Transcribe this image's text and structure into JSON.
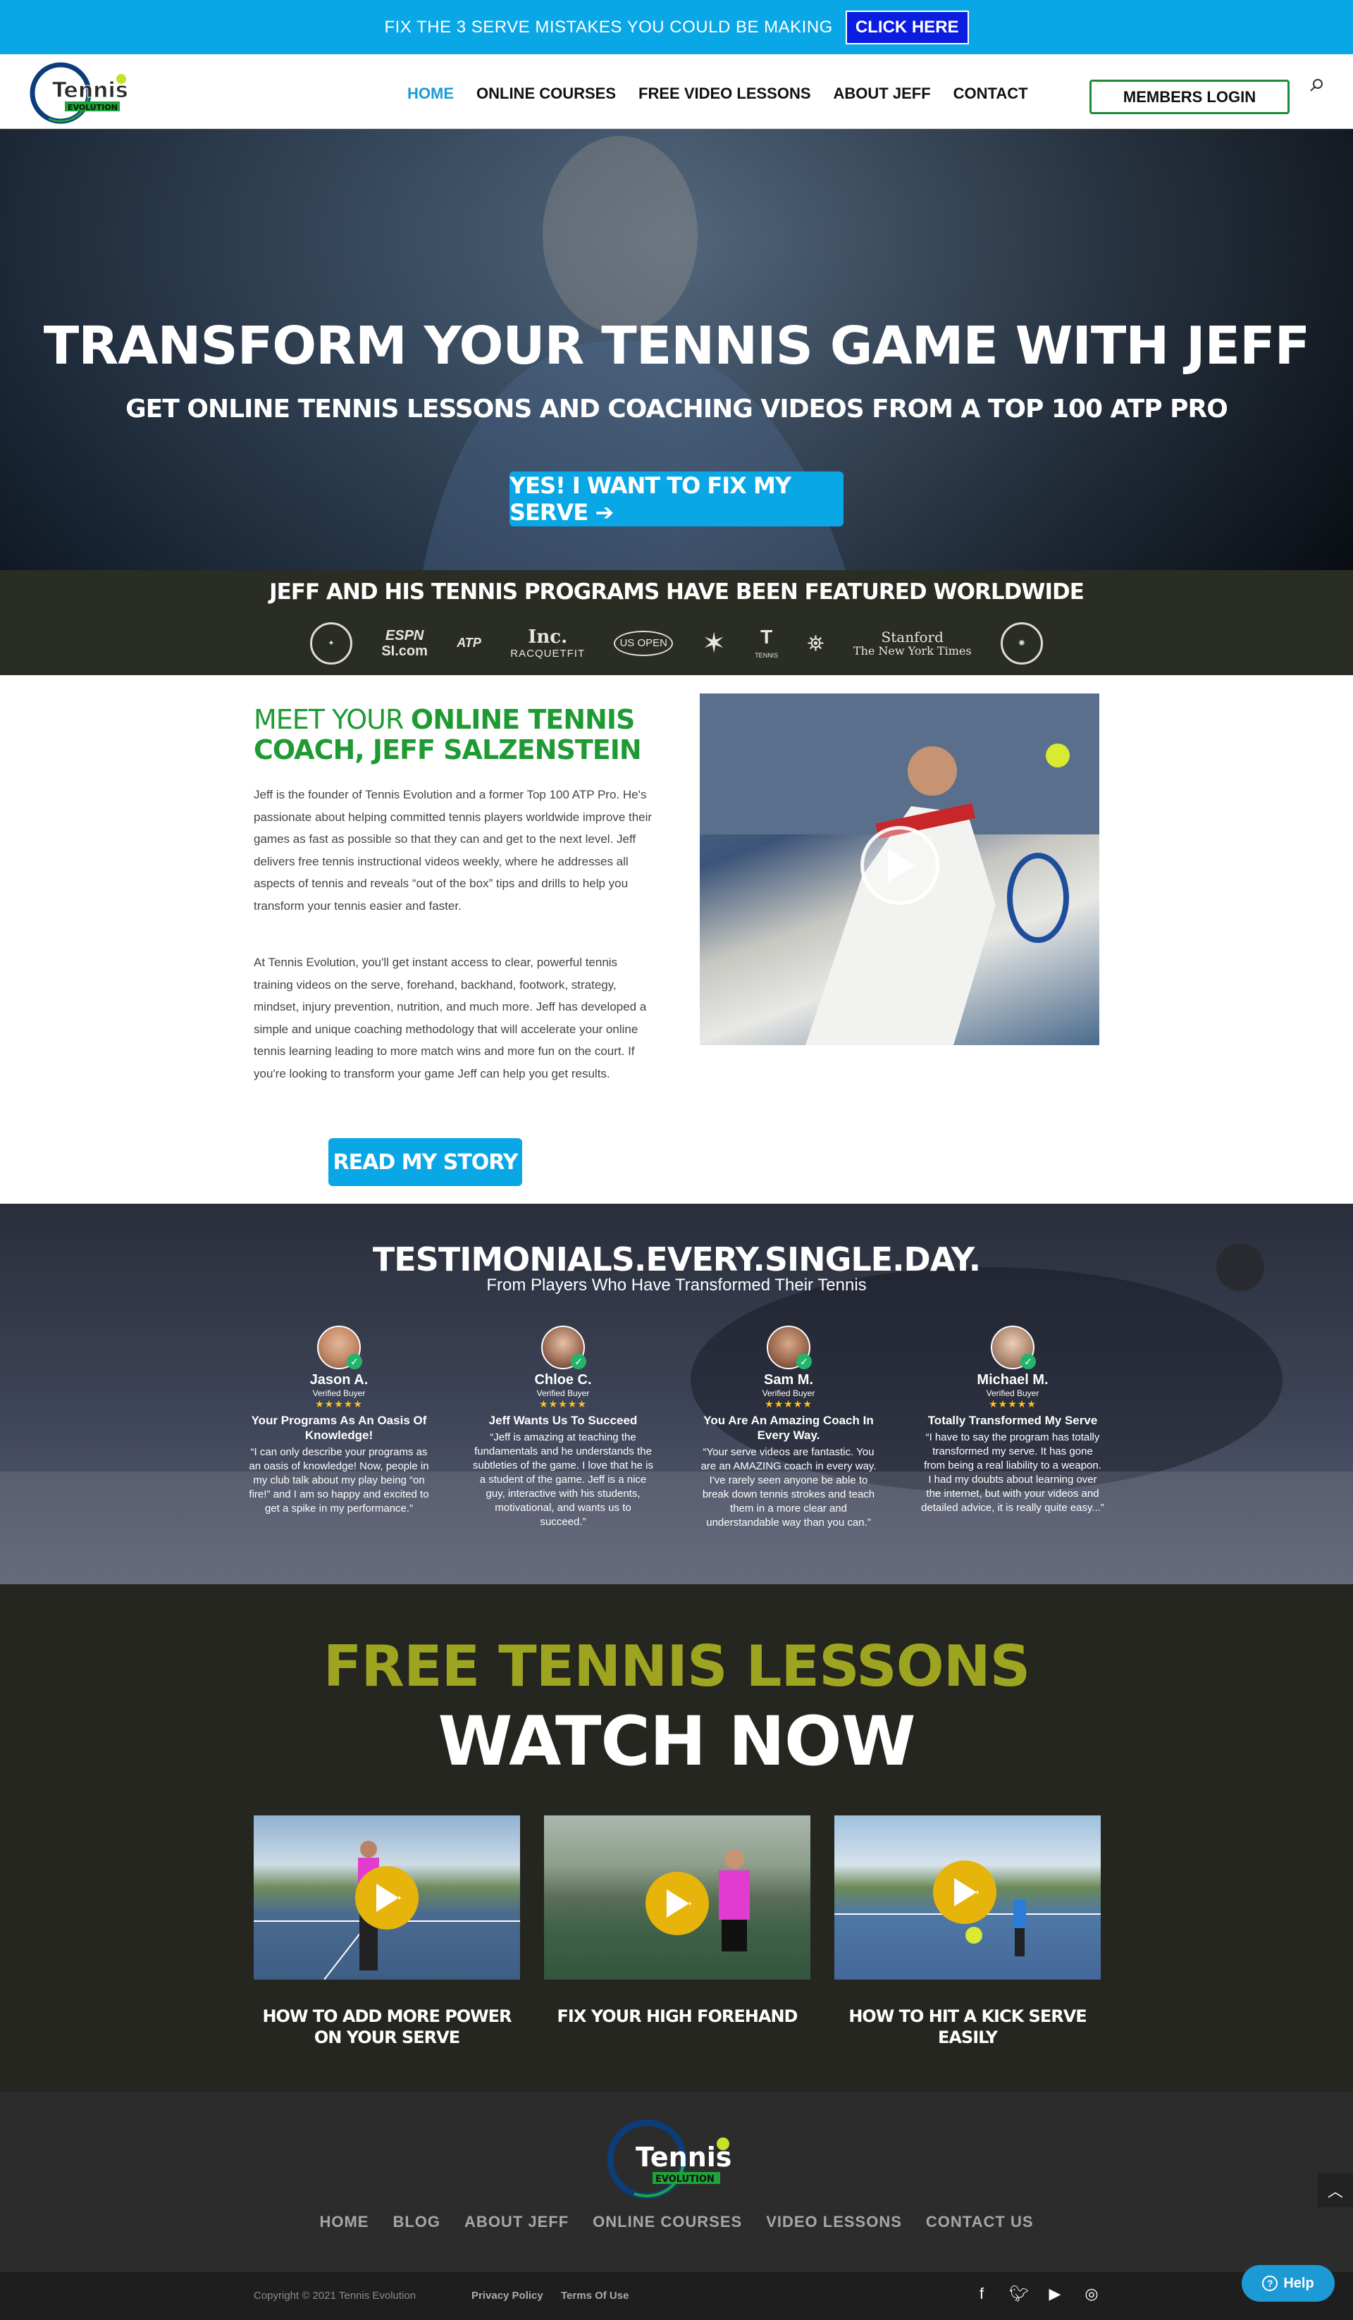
{
  "announcement": {
    "text": "FIX THE 3 SERVE MISTAKES YOU COULD BE MAKING",
    "cta": "CLICK HERE"
  },
  "header": {
    "logo_main": "Tennis",
    "logo_sub": "EVOLUTION",
    "nav": [
      "HOME",
      "ONLINE COURSES",
      "FREE VIDEO LESSONS",
      "ABOUT JEFF",
      "CONTACT"
    ],
    "login": "MEMBERS LOGIN"
  },
  "hero": {
    "title": "TRANSFORM YOUR TENNIS GAME WITH JEFF",
    "subtitle": "GET ONLINE TENNIS LESSONS AND COACHING VIDEOS FROM A TOP 100 ATP PRO",
    "button": "YES! I WANT TO FIX MY SERVE ➔"
  },
  "featured": {
    "title": "JEFF AND HIS TENNIS PROGRAMS HAVE BEEN FEATURED WORLDWIDE",
    "logos": [
      "ESPN",
      "SI.com",
      "ATP",
      "Inc.",
      "RACQUETFIT",
      "US OPEN",
      "TENNIS",
      "Stanford",
      "The New York Times"
    ]
  },
  "meet": {
    "title_light": "MEET YOUR",
    "title_bold": "ONLINE TENNIS COACH, JEFF SALZENSTEIN",
    "para1": "Jeff is the founder of Tennis Evolution and a former Top 100 ATP Pro. He's passionate about helping committed tennis players worldwide improve their games as fast as possible so that they can and get to the next level. Jeff delivers free tennis instructional videos weekly, where he addresses all aspects of tennis and reveals “out of the box” tips and drills to help you transform your tennis easier and faster.",
    "para2": "At Tennis Evolution, you'll get instant access to clear, powerful tennis training videos on the serve, forehand, backhand, footwork, strategy, mindset, injury prevention, nutrition, and much more. Jeff has developed a simple and unique coaching methodology that will accelerate your online tennis learning leading to more match wins and more fun on the court. If you're looking to transform your game Jeff can help you get results.",
    "button": "READ MY STORY"
  },
  "testimonials": {
    "title": "TESTIMONIALS.EVERY.SINGLE.DAY.",
    "subtitle": "From Players Who Have Transformed Their Tennis",
    "items": [
      {
        "name": "Jason A.",
        "verified": "Verified Buyer",
        "stars": "★★★★★",
        "headline": "Your Programs As An Oasis Of Knowledge!",
        "quote": "“I can only describe your programs as an oasis of knowledge! Now, people in my club talk about my play being “on fire!” and I am so happy and excited to get a spike in my performance.”"
      },
      {
        "name": "Chloe C.",
        "verified": "Verified Buyer",
        "stars": "★★★★★",
        "headline": "Jeff Wants Us To Succeed",
        "quote": "“Jeff is amazing at teaching the fundamentals and he understands the subtleties of the game. I love that he is a student of the game. Jeff is a nice guy, interactive with his students, motivational, and wants us to succeed.”"
      },
      {
        "name": "Sam M.",
        "verified": "Verified Buyer",
        "stars": "★★★★★",
        "headline": "You Are An Amazing Coach In Every Way.",
        "quote": "“Your serve videos are fantastic. You are an AMAZING coach in every way. I've rarely seen anyone be able to break down tennis strokes and teach them in a more clear and understandable way than you can.”"
      },
      {
        "name": "Michael M.",
        "verified": "Verified Buyer",
        "stars": "★★★★★",
        "headline": "Totally Transformed My Serve",
        "quote": "“I have to say the program has totally transformed my serve. It has gone from being a real liability to a weapon. I had my doubts about learning over the internet, but with your videos and detailed advice, it is really quite easy...”"
      }
    ]
  },
  "free": {
    "title": "FREE TENNIS LESSONS",
    "subtitle": "WATCH NOW",
    "lessons": [
      {
        "caption": "HOW TO ADD MORE POWER ON YOUR SERVE"
      },
      {
        "caption": "FIX YOUR HIGH FOREHAND"
      },
      {
        "caption": "HOW TO HIT A KICK SERVE EASILY"
      }
    ]
  },
  "footer": {
    "nav": [
      "HOME",
      "BLOG",
      "ABOUT JEFF",
      "ONLINE COURSES",
      "VIDEO LESSONS",
      "CONTACT US"
    ],
    "copyright": "Copyright © 2021 Tennis Evolution",
    "privacy": "Privacy Policy",
    "terms": "Terms Of Use",
    "help": "Help"
  },
  "colors": {
    "accent_blue": "#0aa7e6",
    "brand_green": "#1f9a33",
    "olive": "#9da41f",
    "dark": "#24261f"
  }
}
